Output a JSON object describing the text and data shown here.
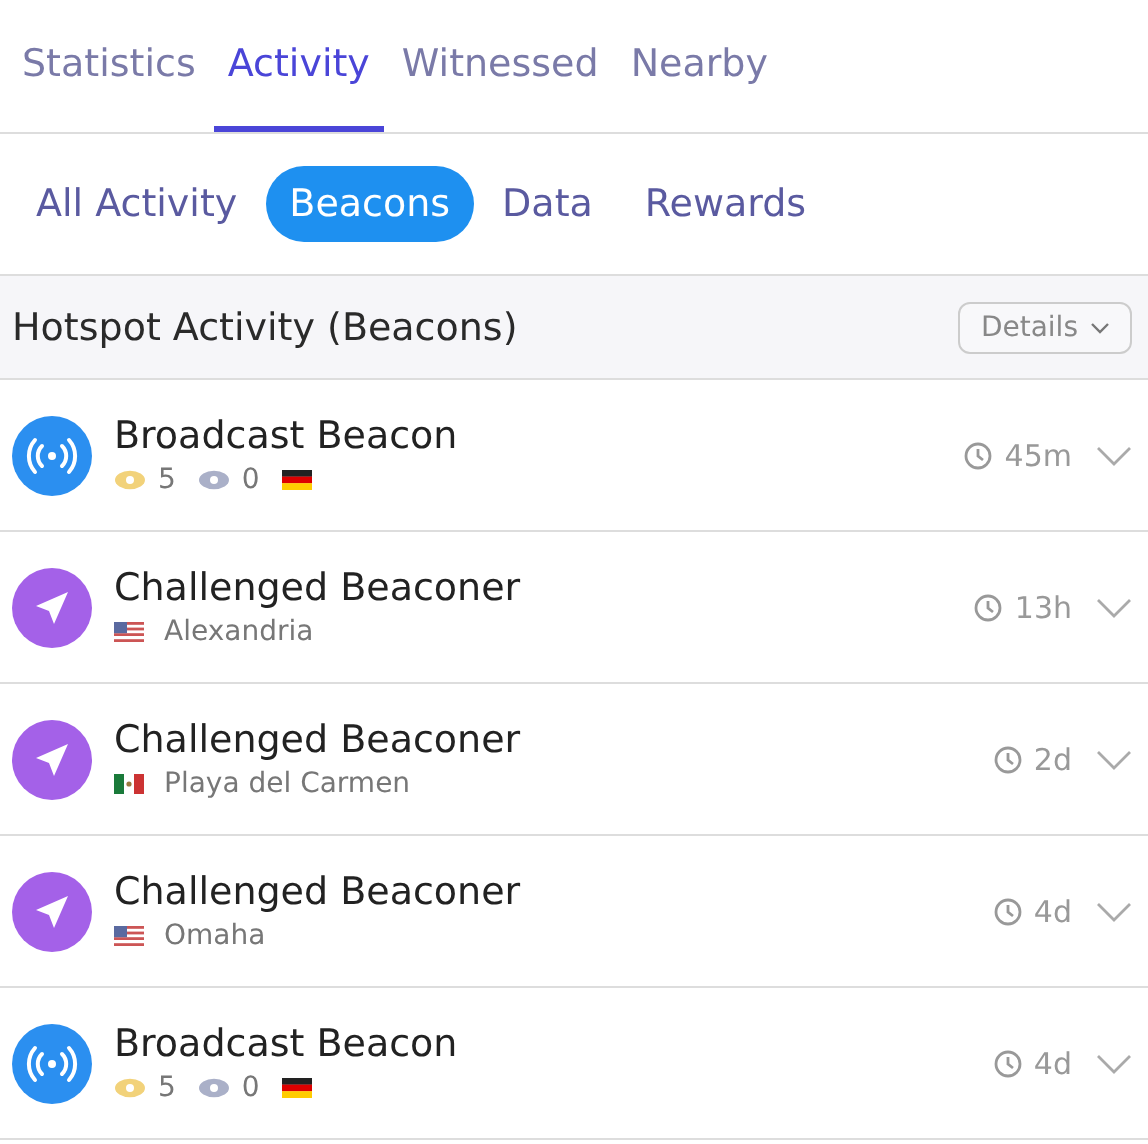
{
  "tabs": [
    {
      "label": "Statistics",
      "selected": false
    },
    {
      "label": "Activity",
      "selected": true
    },
    {
      "label": "Witnessed",
      "selected": false
    },
    {
      "label": "Nearby",
      "selected": false
    }
  ],
  "filters": [
    {
      "label": "All Activity",
      "selected": false
    },
    {
      "label": "Beacons",
      "selected": true
    },
    {
      "label": "Data",
      "selected": false
    },
    {
      "label": "Rewards",
      "selected": false
    }
  ],
  "section": {
    "title": "Hotspot Activity (Beacons)",
    "button": "Details"
  },
  "activities": [
    {
      "kind": "broadcast",
      "title": "Broadcast Beacon",
      "valid": "5",
      "invalid": "0",
      "flag": {
        "kind": "de"
      },
      "time": "45m"
    },
    {
      "kind": "challenged",
      "title": "Challenged Beaconer",
      "flag": {
        "kind": "us"
      },
      "location": "Alexandria",
      "time": "13h"
    },
    {
      "kind": "challenged",
      "title": "Challenged Beaconer",
      "flag": {
        "kind": "mx"
      },
      "location": "Playa del Carmen",
      "time": "2d"
    },
    {
      "kind": "challenged",
      "title": "Challenged Beaconer",
      "flag": {
        "kind": "us"
      },
      "location": "Omaha",
      "time": "4d"
    },
    {
      "kind": "broadcast",
      "title": "Broadcast Beacon",
      "valid": "5",
      "invalid": "0",
      "flag": {
        "kind": "de"
      },
      "time": "4d"
    }
  ]
}
